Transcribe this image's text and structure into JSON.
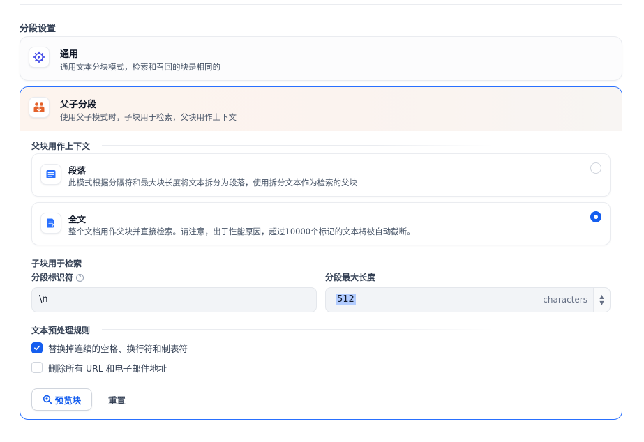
{
  "page": {
    "section_title": "分段设置"
  },
  "general_card": {
    "title": "通用",
    "description": "通用文本分块模式，检索和召回的块是相同的",
    "icon": "gear-icon"
  },
  "parent_child_card": {
    "title": "父子分段",
    "description": "使用父子模式时，子块用于检索，父块用作上下文",
    "icon": "parent-child-icon",
    "parent_context_heading": "父块用作上下文",
    "options": [
      {
        "title": "段落",
        "description": "此模式根据分隔符和最大块长度将文本拆分为段落，使用拆分文本作为检索的父块",
        "icon": "paragraph-icon",
        "selected": false
      },
      {
        "title": "全文",
        "description": "整个文档用作父块并直接检索。请注意，出于性能原因，超过10000个标记的文本将被自动截断。",
        "icon": "document-icon",
        "selected": true
      }
    ],
    "child_heading": "子块用于检索",
    "separator": {
      "label": "分段标识符",
      "value": "\\n"
    },
    "max_length": {
      "label": "分段最大长度",
      "value": "512",
      "unit": "characters"
    },
    "preprocess": {
      "heading": "文本预处理规则",
      "rules": [
        {
          "label": "替换掉连续的空格、换行符和制表符",
          "checked": true
        },
        {
          "label": "删除所有 URL 和电子邮件地址",
          "checked": false
        }
      ]
    },
    "actions": {
      "preview_label": "预览块",
      "reset_label": "重置"
    }
  },
  "colors": {
    "accent": "#155eef",
    "active_border": "#2970ff",
    "header_tint": "#fdf4ee",
    "child_icon_orange": "#e4622b",
    "gear_icon_purple": "#444ce7"
  }
}
